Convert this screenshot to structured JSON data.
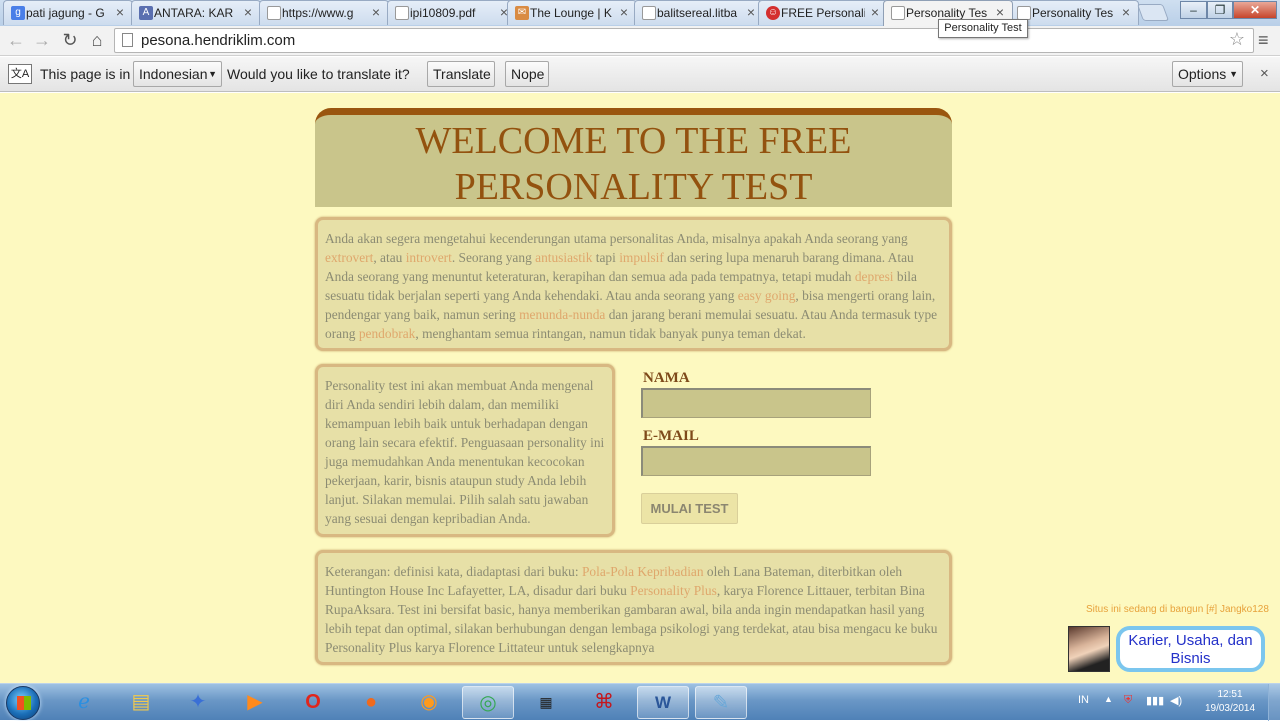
{
  "browser": {
    "tabs": [
      {
        "title": "pati jagung - G",
        "icon": "google-icon",
        "color": "#4a7fe8",
        "glyph": "g"
      },
      {
        "title": "ANTARA: KAR",
        "icon": "antara-icon",
        "color": "#5a6fb0",
        "glyph": "A"
      },
      {
        "title": "https://www.g",
        "icon": "page-icon",
        "color": "#ffffff",
        "glyph": ""
      },
      {
        "title": "ipi10809.pdf",
        "icon": "page-icon",
        "color": "#ffffff",
        "glyph": ""
      },
      {
        "title": "The Lounge | K",
        "icon": "lounge-icon",
        "color": "#d98b43",
        "glyph": "✉"
      },
      {
        "title": "balitsereal.litba",
        "icon": "page-icon",
        "color": "#ffffff",
        "glyph": ""
      },
      {
        "title": "FREE Personali",
        "icon": "opera-icon",
        "color": "#d42f2f",
        "glyph": "☺"
      },
      {
        "title": "Personality Tes",
        "icon": "page-icon",
        "color": "#ffffff",
        "glyph": "",
        "active": true
      },
      {
        "title": "Personality Tes",
        "icon": "page-icon",
        "color": "#ffffff",
        "glyph": ""
      }
    ],
    "tooltip": "Personality Test",
    "url": "pesona.hendriklim.com",
    "translate_bar": {
      "prefix": "This page is in",
      "language": "Indonesian",
      "question": "Would you like to translate it?",
      "translate_label": "Translate",
      "nope_label": "Nope",
      "options_label": "Options"
    }
  },
  "page": {
    "heading_line1": "WELCOME TO THE FREE",
    "heading_line2": "PERSONALITY TEST",
    "intro": {
      "t1": "Anda akan segera mengetahui kecenderungan utama personalitas Anda, misalnya apakah Anda seorang yang ",
      "l1": "extrovert",
      "t2": ", atau ",
      "l2": "introvert",
      "t3": ". Seorang yang ",
      "l3": "antusiastik",
      "t4": " tapi ",
      "l4": "impulsif",
      "t5": " dan sering lupa menaruh barang dimana. Atau Anda seorang yang menuntut keteraturan, kerapihan dan semua ada pada tempatnya, tetapi mudah ",
      "l5": "depresi",
      "t6": " bila sesuatu tidak berjalan seperti yang Anda kehendaki. Atau anda seorang yang ",
      "l6": "easy going",
      "t7": ", bisa mengerti orang lain, pendengar yang baik, namun sering ",
      "l7": "menunda-nunda",
      "t8": " dan jarang berani memulai sesuatu. Atau Anda termasuk type orang ",
      "l8": "pendobrak",
      "t9": ", menghantam semua rintangan, namun tidak banyak punya teman dekat."
    },
    "side_text": "Personality test ini akan membuat Anda mengenal diri Anda sendiri lebih dalam, dan memiliki kemampuan lebih baik untuk berhadapan dengan orang lain secara efektif. Penguasaan personality ini juga memudahkan Anda menentukan kecocokan pekerjaan, karir, bisnis ataupun study Anda lebih lanjut. Silakan memulai. Pilih salah satu jawaban yang sesuai dengan kepribadian Anda.",
    "form": {
      "name_label": "NAMA",
      "name_value": "",
      "email_label": "E-MAIL",
      "email_value": "",
      "submit_label": "MULAI TEST"
    },
    "note": {
      "t1": "Keterangan: definisi kata, diadaptasi dari buku: ",
      "l1": "Pola-Pola Kepribadian",
      "t2": " oleh Lana Bateman, diterbitkan oleh Huntington House Inc Lafayetter, LA, disadur dari buku ",
      "l2": "Personality Plus",
      "t3": ", karya Florence Littauer, terbitan Bina RupaAksara. Test ini bersifat basic, hanya memberikan gambaran awal, bila anda ingin mendapatkan hasil yang lebih tepat dan optimal, silakan berhubungan dengan lembaga psikologi yang terdekat, atau bisa mengacu ke buku Personality Plus karya Florence Littateur untuk selengkapnya"
    },
    "footer_notice": "Situs ini sedang di bangun [#] Jangko128",
    "widget_label": "Karier, Usaha, dan Bisnis"
  },
  "colors": {
    "page_bg": "#fdf9c0",
    "header_bg": "#c9c58b",
    "heading_text": "#93520f",
    "link": "#dfa76c",
    "body_text": "#8c8c73"
  },
  "taskbar": {
    "apps": [
      "ie-icon",
      "explorer-icon",
      "app-icon",
      "media-icon",
      "opera-icon",
      "firefox-icon",
      "app-icon",
      "chrome-icon",
      "calendar-icon",
      "acrobat-icon",
      "word-icon",
      "paint-icon"
    ],
    "lang": "IN",
    "time": "12:51",
    "date": "19/03/2014"
  }
}
